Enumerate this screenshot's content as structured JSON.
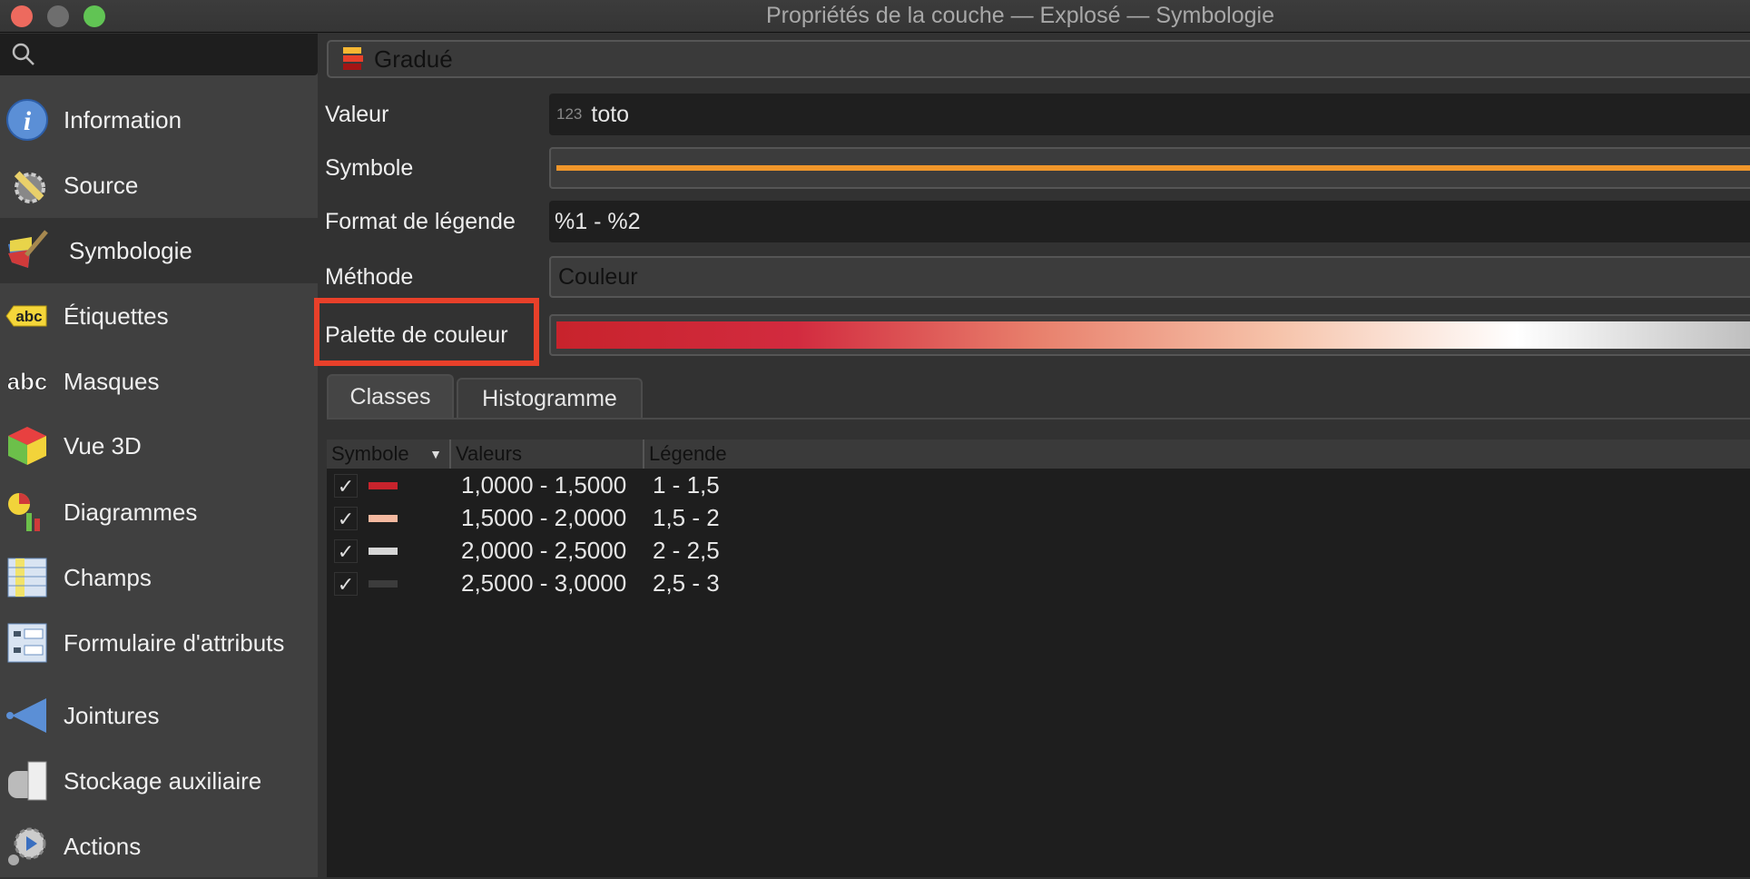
{
  "window": {
    "title": "Propriétés de la couche — Explosé — Symbologie",
    "controls": {
      "close": "#ed6a5e",
      "minimize": "#6e6e6e",
      "maximize": "#61c454"
    }
  },
  "sidebar": {
    "search_placeholder": "",
    "selected": "Symbologie",
    "items": [
      {
        "label": "Information",
        "icon": "info-icon"
      },
      {
        "label": "Source",
        "icon": "source-icon"
      },
      {
        "label": "Symbologie",
        "icon": "symbology-icon"
      },
      {
        "label": "Étiquettes",
        "icon": "labels-icon"
      },
      {
        "label": "Masques",
        "icon": "masks-icon"
      },
      {
        "label": "Vue 3D",
        "icon": "3d-view-icon"
      },
      {
        "label": "Diagrammes",
        "icon": "diagrams-icon"
      },
      {
        "label": "Champs",
        "icon": "fields-icon"
      },
      {
        "label": "Formulaire d'attributs",
        "icon": "attributes-form-icon"
      },
      {
        "label": "Jointures",
        "icon": "joins-icon"
      },
      {
        "label": "Stockage auxiliaire",
        "icon": "auxiliary-storage-icon"
      },
      {
        "label": "Actions",
        "icon": "actions-icon"
      }
    ]
  },
  "renderer": {
    "label": "Gradué"
  },
  "form": {
    "valeur": {
      "label": "Valeur",
      "type_badge": "123",
      "value": "toto"
    },
    "symbole": {
      "label": "Symbole",
      "color": "#f0962a"
    },
    "format": {
      "label": "Format de légende",
      "value": "%1 - %2"
    },
    "methode": {
      "label": "Méthode",
      "value": "Couleur"
    },
    "palette": {
      "label": "Palette de couleur",
      "ramp": [
        "#c8232c",
        "#d22b3f",
        "#e8806c",
        "#f6c3aa",
        "#ffffff",
        "#bdbdbd"
      ]
    }
  },
  "tabs": [
    {
      "label": "Classes",
      "active": true
    },
    {
      "label": "Histogramme",
      "active": false
    }
  ],
  "table": {
    "columns": [
      "Symbole",
      "Valeurs",
      "Légende"
    ],
    "rows": [
      {
        "checked": true,
        "color": "#c8232c",
        "values": "1,0000 - 1,5000",
        "legend": "1 - 1,5"
      },
      {
        "checked": true,
        "color": "#f4b9a0",
        "values": "1,5000 - 2,0000",
        "legend": "1,5 - 2"
      },
      {
        "checked": true,
        "color": "#d6d6d6",
        "values": "2,0000 - 2,5000",
        "legend": "2 - 2,5"
      },
      {
        "checked": true,
        "color": "#3c3c3c",
        "values": "2,5000 - 3,0000",
        "legend": "2,5 - 3"
      }
    ]
  }
}
